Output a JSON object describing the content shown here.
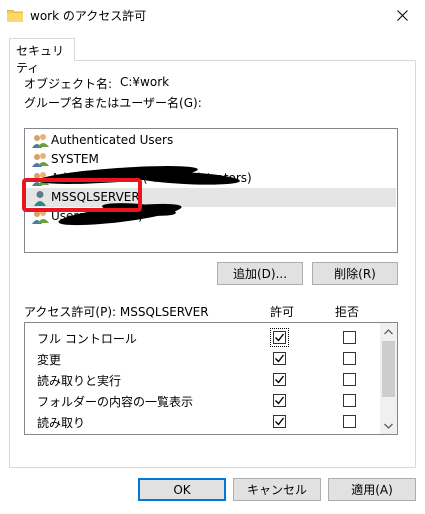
{
  "window": {
    "title": "work のアクセス許可",
    "close_glyph": "✕"
  },
  "tabs": [
    {
      "label": "セキュリティ"
    }
  ],
  "object": {
    "label": "オブジェクト名:",
    "value": "C:¥work"
  },
  "groups_label": "グループ名またはユーザー名(G):",
  "principals": [
    {
      "name": "Authenticated Users",
      "icon": "users-icon"
    },
    {
      "name": "SYSTEM",
      "icon": "users-icon"
    },
    {
      "name": "Administrators (                     ¥Administrators)",
      "icon": "users-icon"
    },
    {
      "name": "MSSQLSERVER",
      "icon": "user-icon",
      "selected": true
    },
    {
      "name": "Users (                   ¥Users)",
      "icon": "users-icon"
    }
  ],
  "buttons": {
    "add": "追加(D)...",
    "remove": "削除(R)",
    "ok": "OK",
    "cancel": "キャンセル",
    "apply": "適用(A)"
  },
  "permissions": {
    "label": "アクセス許可(P): MSSQLSERVER",
    "allow_header": "許可",
    "deny_header": "拒否",
    "rows": [
      {
        "name": "フル コントロール",
        "allow": true,
        "deny": false
      },
      {
        "name": "変更",
        "allow": true,
        "deny": false
      },
      {
        "name": "読み取りと実行",
        "allow": true,
        "deny": false
      },
      {
        "name": "フォルダーの内容の一覧表示",
        "allow": true,
        "deny": false
      },
      {
        "name": "読み取り",
        "allow": true,
        "deny": false
      }
    ]
  },
  "colors": {
    "highlight": "#e8161e",
    "accent": "#0078d7",
    "folder": "#f3c94e"
  }
}
